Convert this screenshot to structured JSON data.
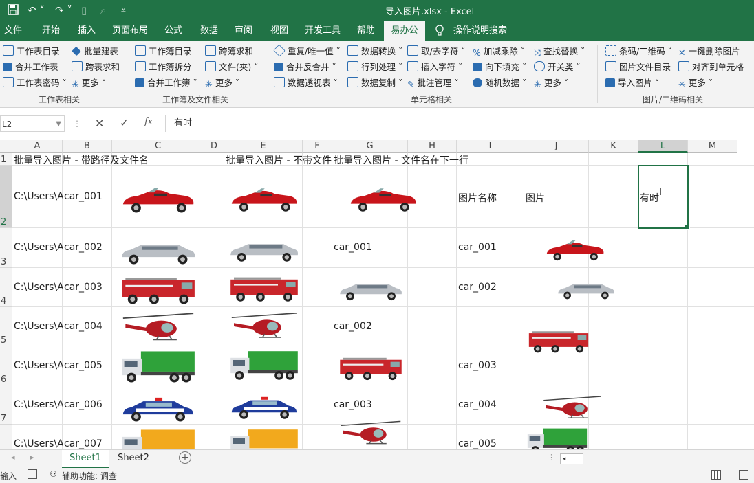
{
  "titlebar": {
    "title": "导入图片.xlsx  -  Excel",
    "qa_icons": [
      "save-icon",
      "undo-icon",
      "redo-icon",
      "new-file-icon",
      "print-preview-icon",
      "customize-icon"
    ]
  },
  "tabs": [
    "文件",
    "开始",
    "插入",
    "页面布局",
    "公式",
    "数据",
    "审阅",
    "视图",
    "开发工具",
    "帮助",
    "易办公",
    "操作说明搜索"
  ],
  "active_tab": "易办公",
  "ribbon": {
    "groups": [
      {
        "title": "工作表相关",
        "items": [
          "工作表目录",
          "批量建表",
          "合并工作表",
          "跨表求和",
          "工作表密码 ˅",
          "更多 ˅"
        ]
      },
      {
        "title": "工作簿及文件相关",
        "items": [
          "工作簿目录",
          "跨簿求和",
          "工作簿拆分",
          "文件(夹) ˅",
          "合并工作簿 ˅",
          "更多 ˅"
        ]
      },
      {
        "title": "单元格相关",
        "items": [
          "重复/唯一值 ˅",
          "数据转换 ˅",
          "取/去字符 ˅",
          "加减乘除 ˅",
          "查找替换 ˅",
          "合并反合并 ˅",
          "行列处理 ˅",
          "插入字符 ˅",
          "向下填充 ˅",
          "开关类 ˅",
          "数据透视表 ˅",
          "数据复制 ˅",
          "批注管理 ˅",
          "随机数据 ˅",
          "更多 ˅"
        ]
      },
      {
        "title": "图片/二维码相关",
        "items": [
          "条码/二维码 ˅",
          "一键删除图片",
          "图片文件目录",
          "对齐到单元格",
          "导入图片 ˅",
          "更多 ˅"
        ]
      }
    ]
  },
  "formula_bar": {
    "name_box": "L2",
    "content": "有时",
    "fx_label": "fx"
  },
  "columns": [
    "A",
    "B",
    "C",
    "D",
    "E",
    "F",
    "G",
    "H",
    "I",
    "J",
    "K",
    "L",
    "M"
  ],
  "rows": [
    "1",
    "2",
    "3",
    "4",
    "5",
    "6",
    "7"
  ],
  "selected": {
    "col": "L",
    "row": "2"
  },
  "cells": {
    "A1": "批量导入图片 - 带路径及文件名",
    "E1": "批量导入图片 - 不带文件",
    "G1": "批量导入图片 - 文件名在下一行",
    "A2": "C:\\Users\\A",
    "B2": "car_001",
    "I2": "图片名称",
    "J2": "图片",
    "L2": "有时",
    "A3": "C:\\Users\\A",
    "B3": "car_002",
    "G3": "car_001",
    "I3": "car_001",
    "A4": "C:\\Users\\A",
    "B4": "car_003",
    "I4": "car_002",
    "A5": "C:\\Users\\A",
    "B5": "car_004",
    "G5": "car_002",
    "A6": "C:\\Users\\A",
    "B6": "car_005",
    "I6": "car_003",
    "A7": "C:\\Users\\A",
    "B7": "car_006",
    "G7": "car_003",
    "I7": "car_004",
    "A8": "C:\\Users\\A",
    "B8": "car_007",
    "I8": "car_005"
  },
  "pictures": [
    "red-convertible",
    "silver-limousine",
    "fire-truck",
    "helicopter",
    "green-cargo-truck",
    "police-car",
    "yellow-truck"
  ],
  "sheets": [
    "Sheet1",
    "Sheet2"
  ],
  "active_sheet": "Sheet1",
  "status": {
    "mode": "输入",
    "accessibility": "辅助功能: 调查"
  }
}
